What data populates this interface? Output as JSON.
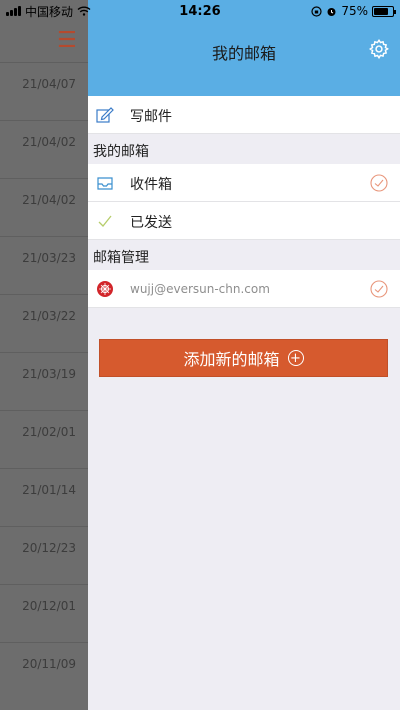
{
  "status_bar": {
    "carrier": "中国移动",
    "time": "14:26",
    "battery": "75%"
  },
  "background_list": {
    "dates": [
      "21/04/07",
      "21/04/02",
      "21/04/02",
      "21/03/23",
      "21/03/22",
      "21/03/19",
      "21/02/01",
      "21/01/14",
      "20/12/23",
      "20/12/01",
      "20/11/09"
    ]
  },
  "drawer": {
    "title": "我的邮箱",
    "compose": "写邮件",
    "section_mailbox": "我的邮箱",
    "inbox": "收件箱",
    "sent": "已发送",
    "section_manage": "邮箱管理",
    "account": "wujj@eversun-chn.com",
    "add_button": "添加新的邮箱"
  },
  "colors": {
    "header": "#5aaee4",
    "accent": "#d65a2e"
  }
}
